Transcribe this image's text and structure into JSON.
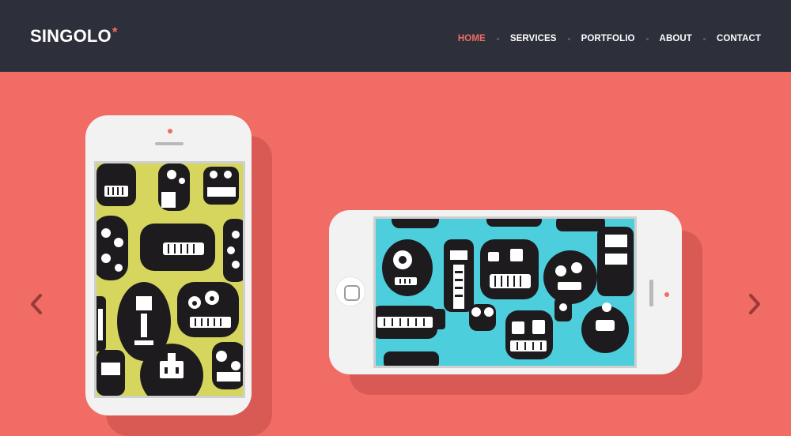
{
  "header": {
    "logo": {
      "text": "SINGOLO",
      "star": "*"
    },
    "nav": [
      {
        "label": "HOME",
        "active": true
      },
      {
        "label": "SERVICES",
        "active": false
      },
      {
        "label": "PORTFOLIO",
        "active": false
      },
      {
        "label": "ABOUT",
        "active": false
      },
      {
        "label": "CONTACT",
        "active": false
      }
    ]
  },
  "slider": {
    "prev_icon": "chevron-left-icon",
    "next_icon": "chevron-right-icon",
    "slides": [
      {
        "device": "vertical-phone",
        "wallpaper": "monster-pattern-yellow"
      },
      {
        "device": "horizontal-phone",
        "wallpaper": "monster-pattern-blue"
      }
    ]
  },
  "colors": {
    "header_bg": "#2d303a",
    "accent": "#f06c64",
    "slider_bg": "#f06c64",
    "phone_body": "#f2f2f2",
    "wallpaper_yellow": "#d6d65e",
    "wallpaper_blue": "#4ccedc",
    "monster": "#1d1b1d"
  }
}
